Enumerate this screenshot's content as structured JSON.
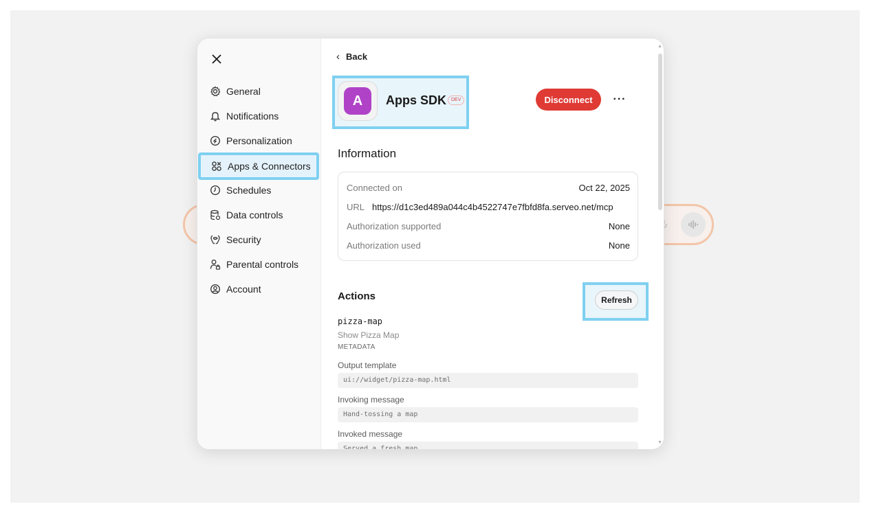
{
  "sidebar": {
    "close_icon": "close-icon",
    "items": [
      {
        "label": "General",
        "icon": "gear-icon"
      },
      {
        "label": "Notifications",
        "icon": "bell-icon"
      },
      {
        "label": "Personalization",
        "icon": "personalization-icon"
      },
      {
        "label": "Apps & Connectors",
        "icon": "apps-icon",
        "active": true
      },
      {
        "label": "Schedules",
        "icon": "clock-icon"
      },
      {
        "label": "Data controls",
        "icon": "database-icon"
      },
      {
        "label": "Security",
        "icon": "shield-icon"
      },
      {
        "label": "Parental controls",
        "icon": "parental-icon"
      },
      {
        "label": "Account",
        "icon": "account-icon"
      }
    ]
  },
  "content": {
    "back_label": "Back",
    "app": {
      "logo_letter": "A",
      "logo_color": "#b042c8",
      "name": "Apps SDK",
      "badge": "DEV"
    },
    "disconnect_label": "Disconnect",
    "more_label": "···",
    "information": {
      "title": "Information",
      "rows": [
        {
          "key": "Connected on",
          "value": "Oct 22, 2025"
        },
        {
          "key": "URL",
          "value": "https://d1c3ed489a044c4b4522747e7fbfd8fa.serveo.net/mcp"
        },
        {
          "key": "Authorization supported",
          "value": "None"
        },
        {
          "key": "Authorization used",
          "value": "None"
        }
      ]
    },
    "actions": {
      "title": "Actions",
      "refresh_label": "Refresh",
      "tool": {
        "name": "pizza-map",
        "description": "Show Pizza Map",
        "metadata_label": "METADATA",
        "fields": [
          {
            "label": "Output template",
            "value": "ui://widget/pizza-map.html"
          },
          {
            "label": "Invoking message",
            "value": "Hand-tossing a map"
          },
          {
            "label": "Invoked message",
            "value": "Served a fresh map"
          }
        ]
      }
    }
  },
  "colors": {
    "disconnect": "#df3a34",
    "highlight": "#7fd0f0",
    "composer_border": "#f3c5a8"
  }
}
